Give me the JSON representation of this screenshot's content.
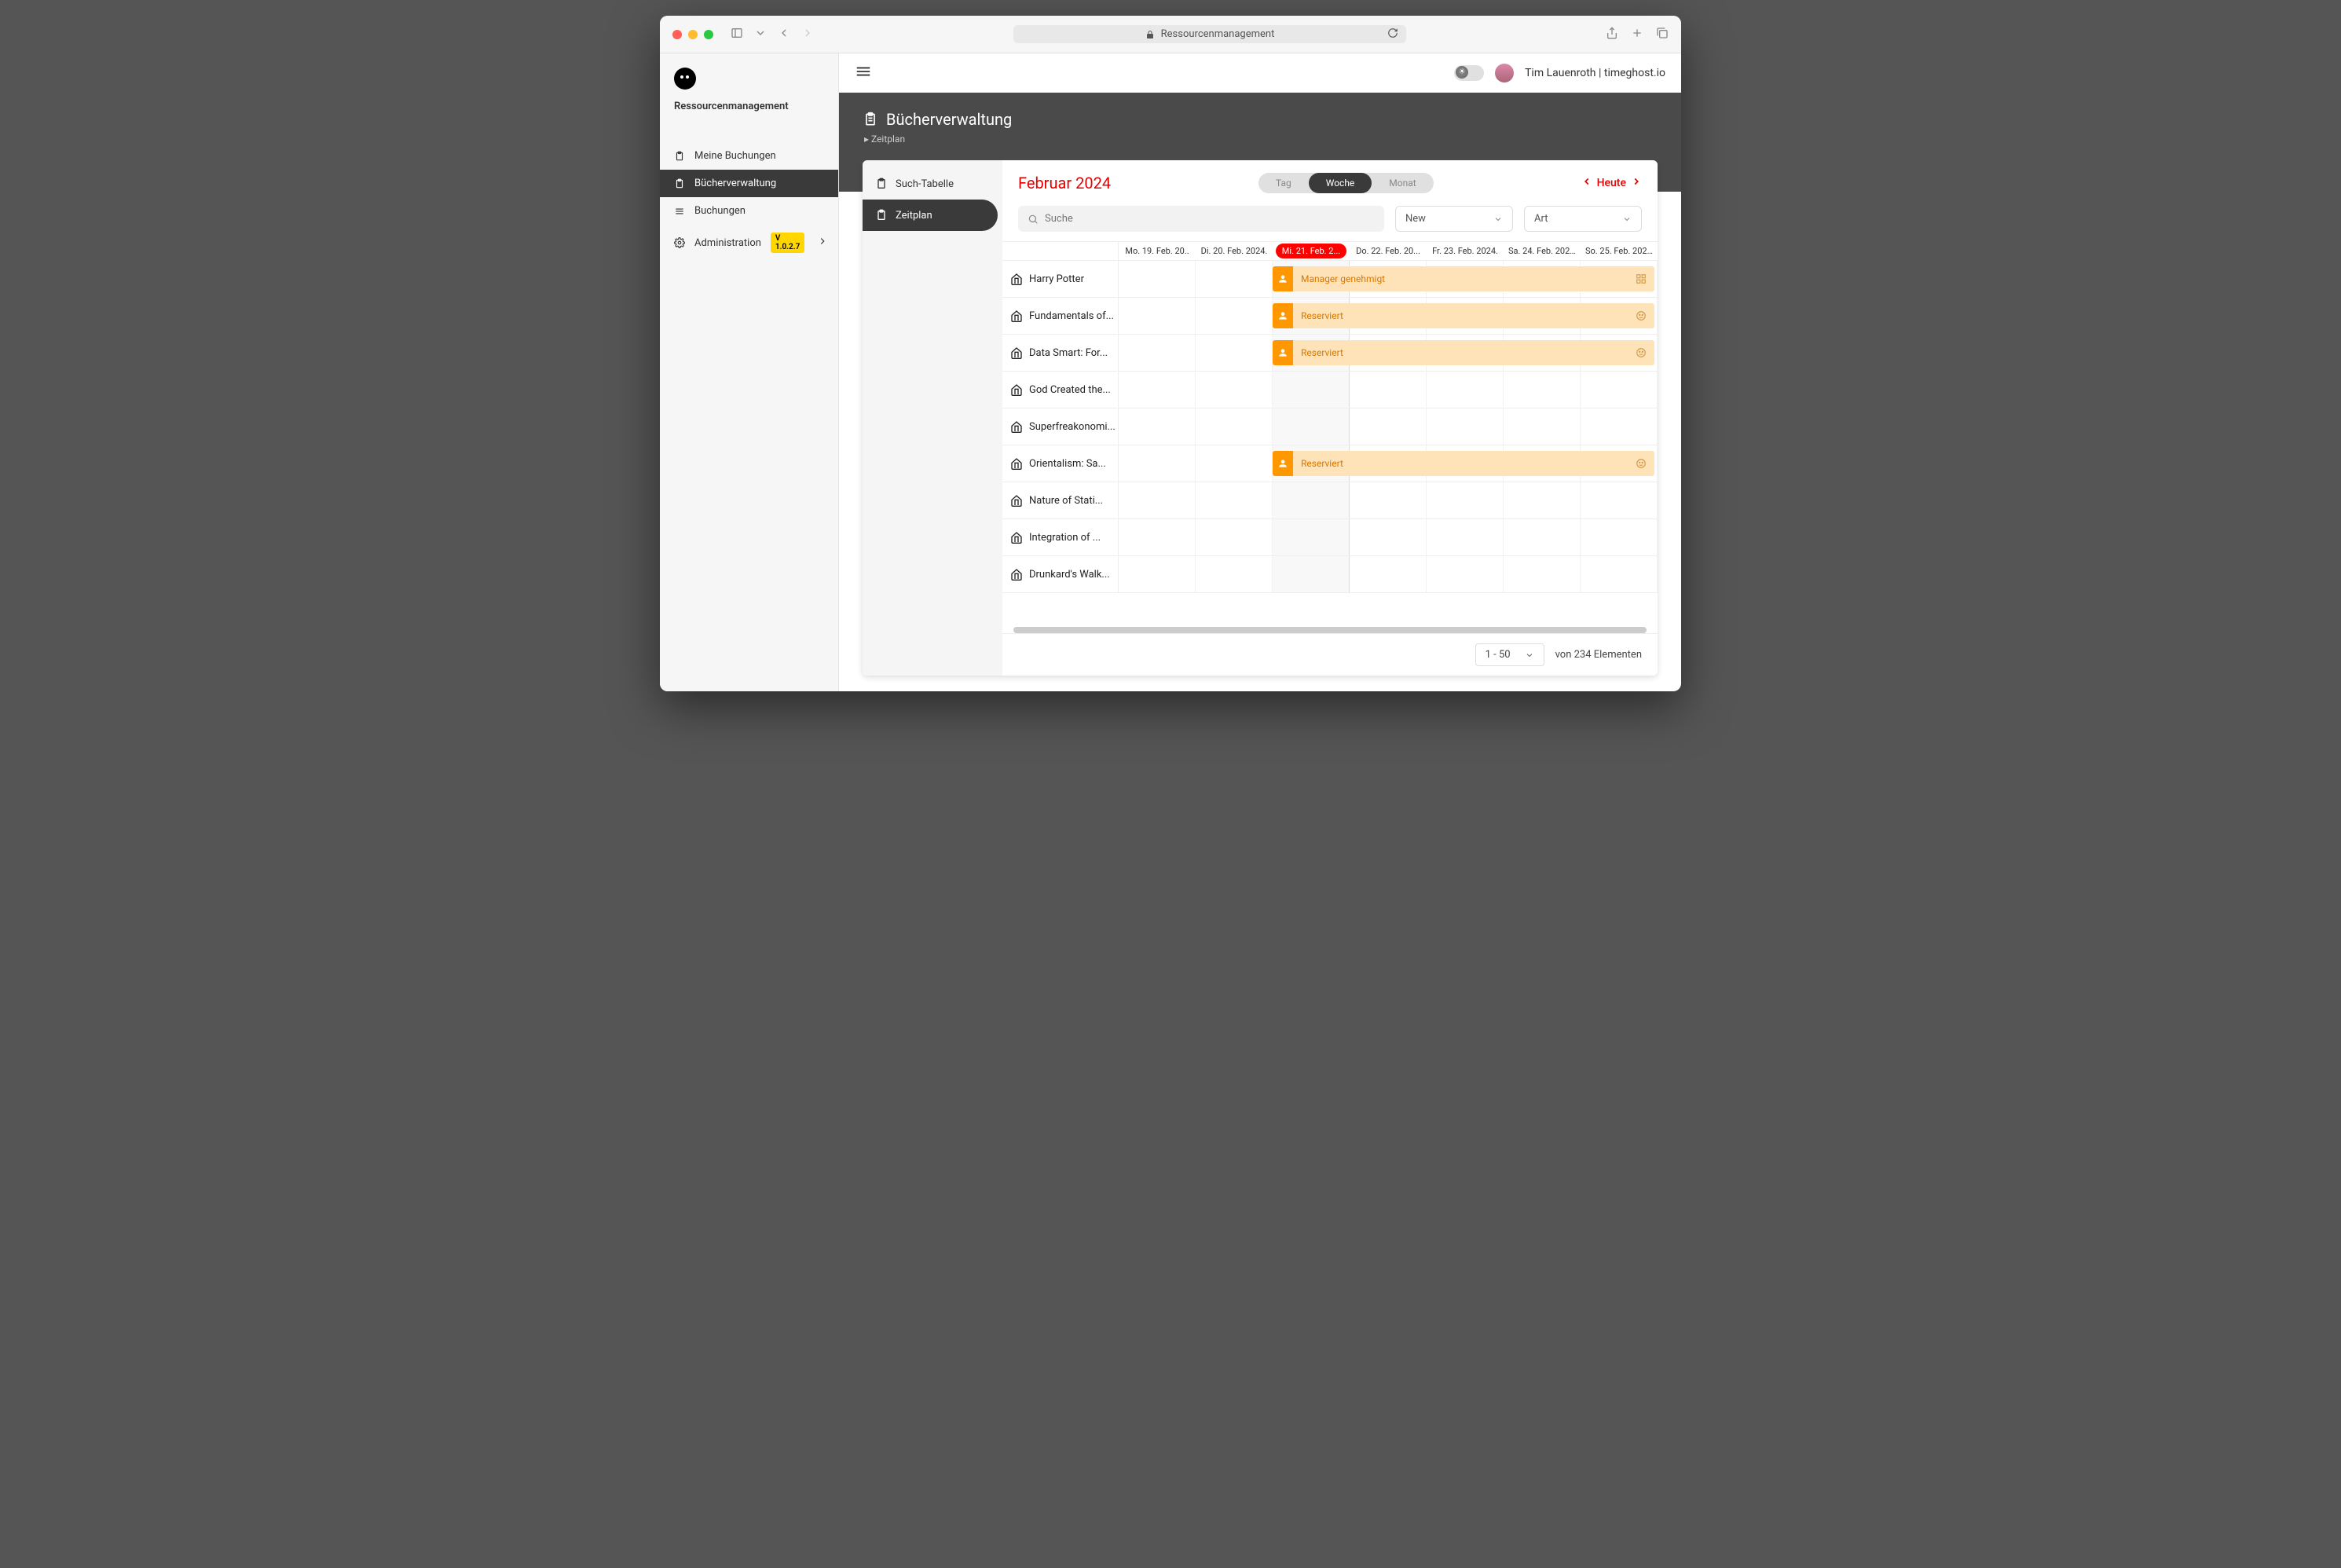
{
  "browser": {
    "url_label": "Ressourcenmanagement"
  },
  "app_title": "Ressourcenmanagement",
  "user": {
    "display": "Tim Lauenroth | timeghost.io"
  },
  "sidebar": {
    "items": [
      {
        "label": "Meine Buchungen"
      },
      {
        "label": "Bücherverwaltung"
      },
      {
        "label": "Buchungen"
      },
      {
        "label": "Administration"
      }
    ],
    "version": "V 1.0.2.7"
  },
  "header": {
    "title": "Bücherverwaltung",
    "breadcrumb": "Zeitplan"
  },
  "subnav": {
    "items": [
      {
        "label": "Such-Tabelle"
      },
      {
        "label": "Zeitplan"
      }
    ]
  },
  "schedule": {
    "month_label": "Februar 2024",
    "views": {
      "day": "Tag",
      "week": "Woche",
      "month": "Monat"
    },
    "today_label": "Heute",
    "search_placeholder": "Suche",
    "filter1": "New",
    "filter2": "Art",
    "days": [
      "Mo. 19. Feb. 20..",
      "Di. 20. Feb. 2024.",
      "Mi. 21. Feb. 2...",
      "Do. 22. Feb. 20...",
      "Fr. 23. Feb. 2024.",
      "Sa. 24. Feb. 2024.",
      "So. 25. Feb. 2024."
    ],
    "today_index": 2,
    "resources": [
      {
        "name": "Harry Potter",
        "booking": "Manager genehmigt",
        "booking_icon": "qr"
      },
      {
        "name": "Fundamentals of...",
        "booking": "Reserviert",
        "booking_icon": "face"
      },
      {
        "name": "Data Smart: For...",
        "booking": "Reserviert",
        "booking_icon": "face"
      },
      {
        "name": "God Created the...",
        "booking": null
      },
      {
        "name": "Superfreakonomi...",
        "booking": null
      },
      {
        "name": "Orientalism: Sa...",
        "booking": "Reserviert",
        "booking_icon": "face"
      },
      {
        "name": "Nature of Stati...",
        "booking": null
      },
      {
        "name": "Integration of ...",
        "booking": null
      },
      {
        "name": "Drunkard's Walk...",
        "booking": null
      }
    ],
    "page_range": "1 - 50",
    "total_text": "von 234 Elementen"
  }
}
